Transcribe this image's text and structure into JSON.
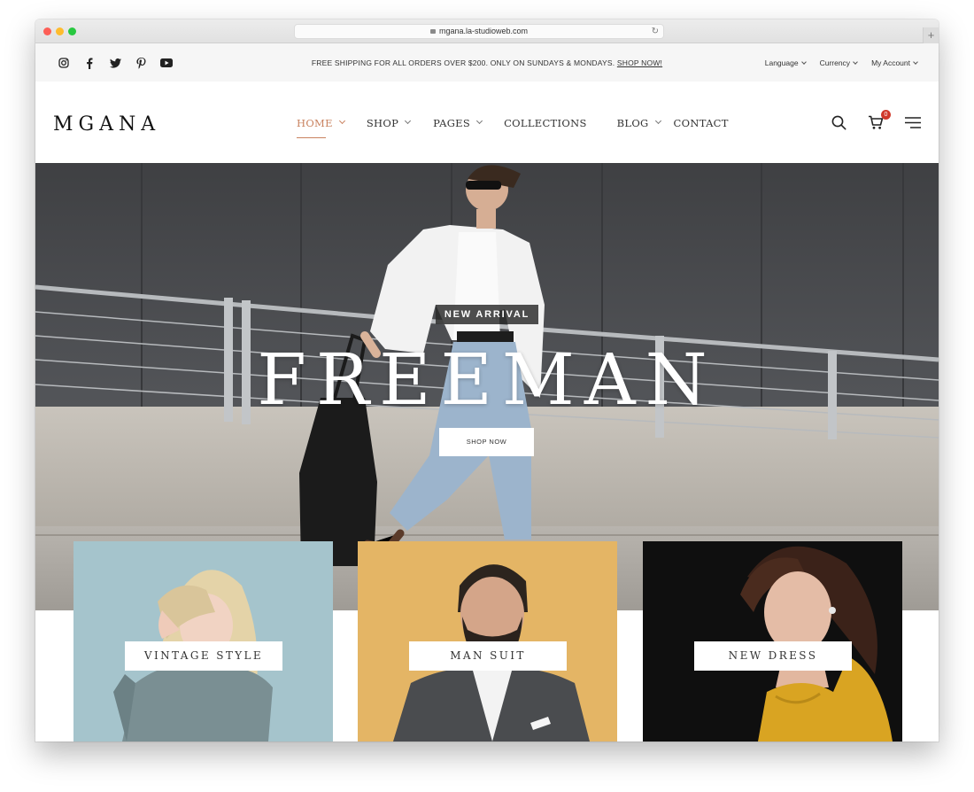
{
  "browser": {
    "url": "mgana.la-studioweb.com",
    "new_tab": "+"
  },
  "topbar": {
    "social": [
      "instagram-icon",
      "facebook-icon",
      "twitter-icon",
      "pinterest-icon",
      "youtube-icon"
    ],
    "promo_text": "FREE SHIPPING FOR ALL ORDERS OVER $200. ONLY ON SUNDAYS & MONDAYS.",
    "promo_link": "SHOP NOW!",
    "language": "Language",
    "currency": "Currency",
    "account": "My Account"
  },
  "header": {
    "logo": "MGANA",
    "nav": [
      {
        "label": "HOME",
        "active": true,
        "dropdown": true
      },
      {
        "label": "SHOP",
        "dropdown": true
      },
      {
        "label": "PAGES",
        "dropdown": true
      },
      {
        "label": "COLLECTIONS",
        "dropdown": false
      },
      {
        "label": "BLOG",
        "dropdown": true
      },
      {
        "label": "CONTACT",
        "dropdown": false
      }
    ],
    "cart_count": "0",
    "accent": "#c9825f"
  },
  "hero": {
    "tag": "NEW ARRIVAL",
    "title": "FREEMAN",
    "button": "SHOP NOW"
  },
  "categories": [
    {
      "label": "VINTAGE STYLE",
      "bg": "#a5c4cc"
    },
    {
      "label": "MAN SUIT",
      "bg": "#e4b565"
    },
    {
      "label": "NEW DRESS",
      "bg": "#0f0f0f"
    }
  ]
}
